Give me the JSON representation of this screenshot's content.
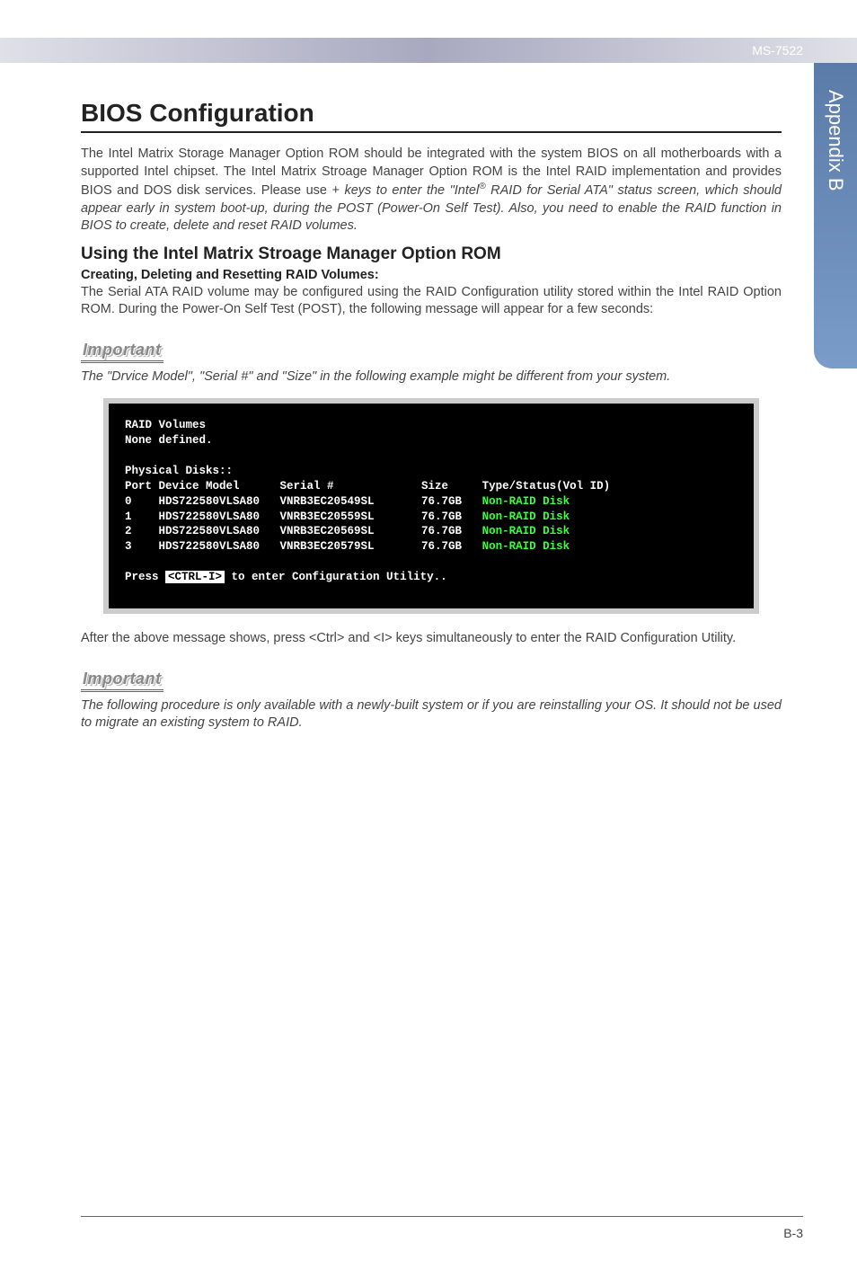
{
  "header_label": "MS-7522",
  "side_tab": "Appendix B",
  "section_title": "BIOS Configuration",
  "intro_paragraph": "The Intel Matrix Storage Manager Option ROM should be integrated with the system BIOS on all motherboards with a supported Intel chipset. The Intel Matrix Stroage Manager Option ROM is the Intel RAID implementation and provides BIOS and DOS disk services. Please use <Ctrl> + <I> keys to enter the \"Intel® RAID for Serial ATA\" status screen, which should  appear early in system boot-up, during the POST (Power-On Self Test). Also, you need to enable the RAID function in BIOS to create, delete and reset RAID volumes.",
  "subhead": "Using the Intel Matrix Stroage Manager Option ROM",
  "boldline": "Creating, Deleting and Resetting RAID Volumes:",
  "para2": "The Serial ATA RAID volume may be configured using the RAID Configuration utility stored within the Intel RAID Option ROM. During the Power-On Self Test (POST), the following message will appear for a few seconds:",
  "important_label": "Important",
  "note1": "The \"Drvice Model\", \"Serial #\" and \"Size\" in the following example might be different from your system.",
  "after_terminal": "After the above message shows, press <Ctrl> and <I> keys simultaneously to enter the RAID Configuration Utility.",
  "note2": "The following procedure is only available with a newly-built system or if you are reinstalling your OS. It should not be used to migrate an existing system to RAID.",
  "page_num": "B-3",
  "terminal": {
    "raid_volumes_label": "RAID Volumes",
    "none_defined": "None defined.",
    "phys_disks": "Physical Disks::",
    "header_row": {
      "port": "Port",
      "device": "Device Model",
      "serial": "Serial #",
      "size": "Size",
      "type": "Type/Status(Vol ID)"
    },
    "rows": [
      {
        "port": "0",
        "device": "HDS722580VLSA80",
        "serial": "VNRB3EC20549SL",
        "size": "76.7GB",
        "type": "Non-RAID Disk"
      },
      {
        "port": "1",
        "device": "HDS722580VLSA80",
        "serial": "VNRB3EC20559SL",
        "size": "76.7GB",
        "type": "Non-RAID Disk"
      },
      {
        "port": "2",
        "device": "HDS722580VLSA80",
        "serial": "VNRB3EC20569SL",
        "size": "76.7GB",
        "type": "Non-RAID Disk"
      },
      {
        "port": "3",
        "device": "HDS722580VLSA80",
        "serial": "VNRB3EC20579SL",
        "size": "76.7GB",
        "type": "Non-RAID Disk"
      }
    ],
    "press_prefix": "Press ",
    "press_key": "<CTRL-I>",
    "press_suffix": " to enter Configuration Utility.."
  }
}
